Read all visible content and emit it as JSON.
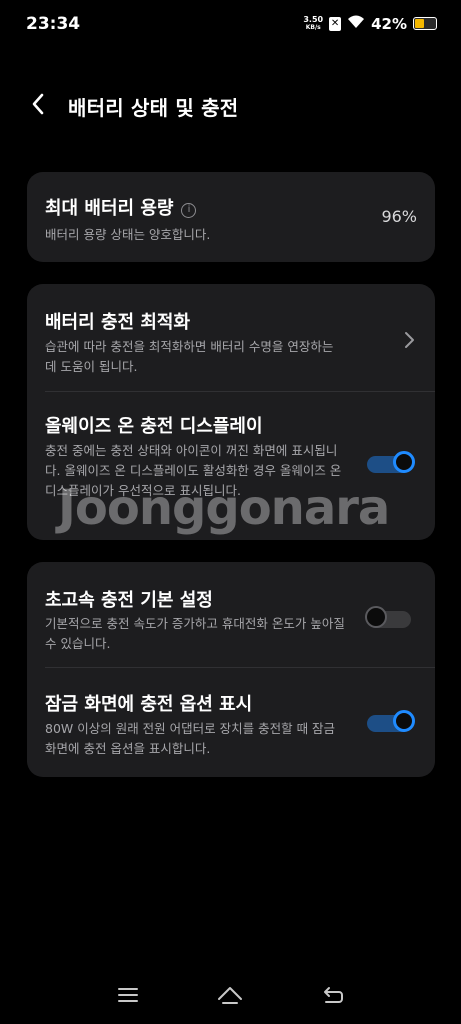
{
  "status_bar": {
    "time": "23:34",
    "net_speed_value": "3.50",
    "net_speed_unit": "KB/s",
    "sim_icon": "sim-disabled-icon",
    "battery_percent": "42%",
    "battery_level": 0.42,
    "battery_color": "#f5b800"
  },
  "header": {
    "title": "배터리 상태 및 충전"
  },
  "card1": {
    "title": "최대 배터리 용량",
    "subtitle": "배터리 용량 상태는 양호합니다.",
    "value": "96%"
  },
  "card2": {
    "item1": {
      "title": "배터리 충전 최적화",
      "subtitle": "습관에 따라 충전을 최적화하면 배터리 수명을 연장하는 데 도움이 됩니다."
    },
    "item2": {
      "title": "올웨이즈 온 충전 디스플레이",
      "subtitle": "충전 중에는 충전 상태와 아이콘이 꺼진 화면에 표시됩니다. 올웨이즈 온 디스플레이도 활성화한 경우 올웨이즈 온 디스플레이가 우선적으로 표시됩니다.",
      "toggle_on": true
    }
  },
  "card3": {
    "item1": {
      "title": "초고속 충전 기본 설정",
      "subtitle": "기본적으로 충전 속도가 증가하고 휴대전화 온도가 높아질 수 있습니다.",
      "toggle_on": false
    },
    "item2": {
      "title": "잠금 화면에 충전 옵션 표시",
      "subtitle": "80W 이상의 원래 전원 어댑터로 장치를 충전할 때 잠금 화면에 충전 옵션을 표시합니다.",
      "toggle_on": true
    }
  },
  "watermark": "Joonggonara",
  "colors": {
    "background": "#000000",
    "card": "#1d1d1f",
    "accent": "#1f8bff",
    "subtext": "#a6a6aa"
  }
}
